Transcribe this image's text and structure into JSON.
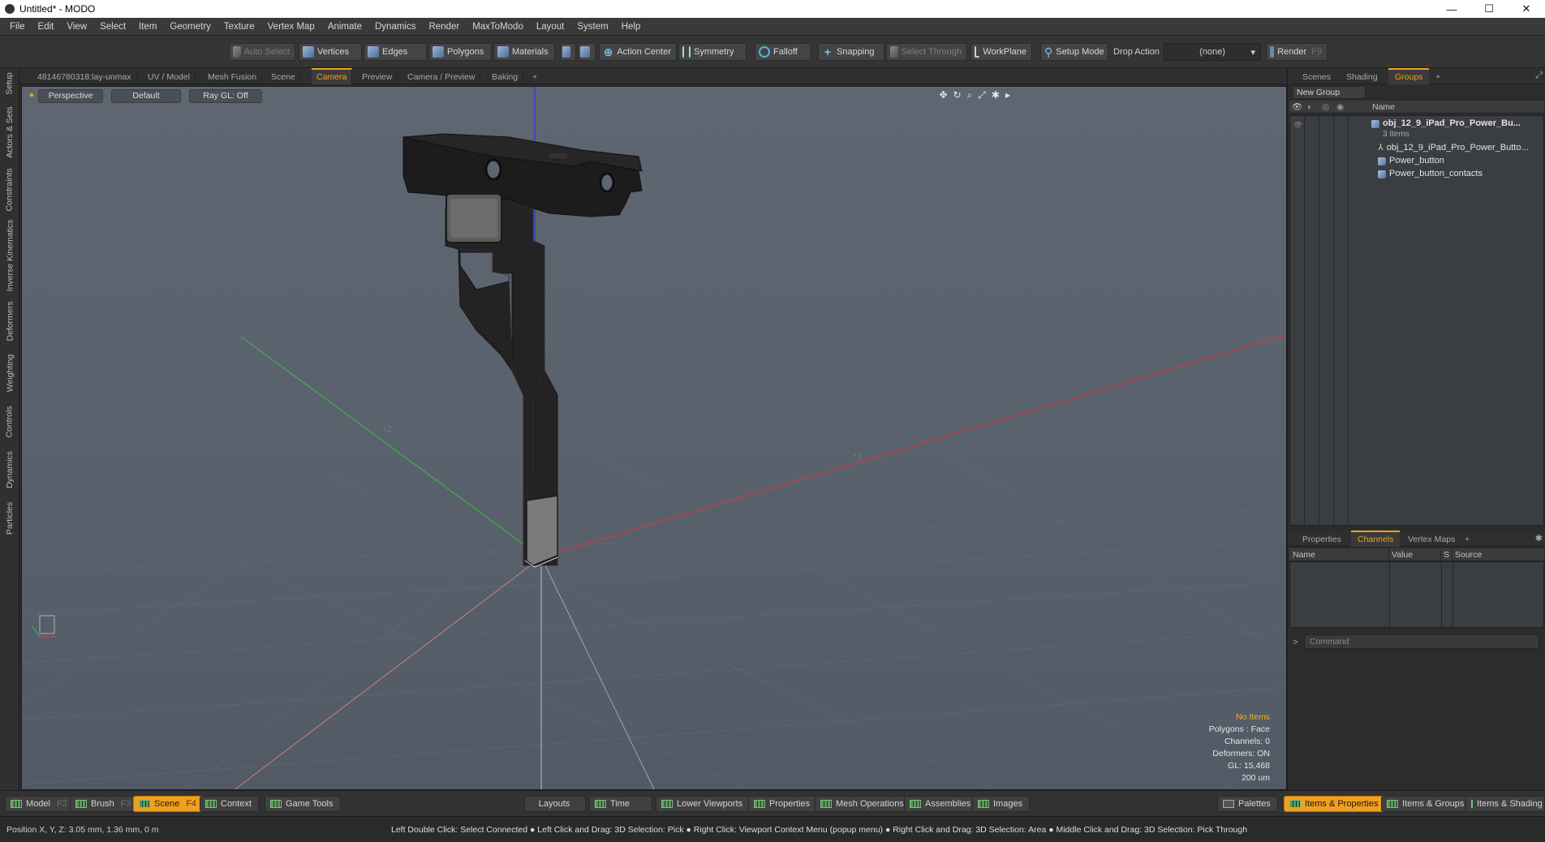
{
  "window": {
    "title": "Untitled* - MODO",
    "controls": [
      "—",
      "☐",
      "✕"
    ]
  },
  "menu": [
    "File",
    "Edit",
    "View",
    "Select",
    "Item",
    "Geometry",
    "Texture",
    "Vertex Map",
    "Animate",
    "Dynamics",
    "Render",
    "MaxToModo",
    "Layout",
    "System",
    "Help"
  ],
  "toolbar": {
    "auto_select": "Auto Select",
    "vertices": "Vertices",
    "edges": "Edges",
    "polygons": "Polygons",
    "materials": "Materials",
    "action_center": "Action Center",
    "symmetry": "Symmetry",
    "falloff": "Falloff",
    "snapping": "Snapping",
    "select_through": "Select Through",
    "workplane": "WorkPlane",
    "setup_mode": "Setup Mode",
    "drop_action_label": "Drop Action",
    "drop_action_value": "(none)",
    "render": "Render",
    "render_key": "F9"
  },
  "left_tabs": [
    "Setup",
    "Actors & Sets",
    "Constraints",
    "Inverse Kinematics",
    "Deformers",
    "Weighting",
    "Controls",
    "Dynamics",
    "Particles"
  ],
  "viewport_tabs": {
    "items": [
      "48146780318:lay-unmax",
      "UV / Model",
      "Mesh Fusion",
      "Scene",
      "Camera",
      "Preview",
      "Camera / Preview",
      "Baking",
      "+"
    ],
    "active": "Camera"
  },
  "viewport": {
    "view_mode": "Perspective",
    "shading": "Default",
    "raygl": "Ray GL: Off",
    "axis_labels": {
      "z": "+Z",
      "x": "+X"
    },
    "info": {
      "items": "No Items",
      "polygons": "Polygons : Face",
      "channels": "Channels: 0",
      "deformers": "Deformers: ON",
      "gl": "GL: 15,468",
      "scale": "200 um"
    }
  },
  "right_panel": {
    "tabs": [
      "Scenes",
      "Shading",
      "Groups",
      "+"
    ],
    "active_tab": "Groups",
    "new_group": "New Group",
    "name_header": "Name",
    "tree": {
      "root": "obj_12_9_iPad_Pro_Power_Bu...",
      "root_sub": "3 Items",
      "children": [
        "obj_12_9_iPad_Pro_Power_Butto...",
        "Power_button",
        "Power_button_contacts"
      ]
    },
    "bottom_tabs": [
      "Properties",
      "Channels",
      "Vertex Maps",
      "+"
    ],
    "bottom_active": "Channels",
    "channel_headers": {
      "name": "Name",
      "value": "Value",
      "s": "S",
      "source": "Source"
    },
    "command_placeholder": "Command"
  },
  "bottom_bar": {
    "model": "Model",
    "model_key": "F2",
    "brush": "Brush",
    "brush_key": "F3",
    "scene": "Scene",
    "scene_key": "F4",
    "context": "Context",
    "game_tools": "Game Tools",
    "layouts": "Layouts",
    "time": "Time",
    "lower_viewports": "Lower Viewports",
    "properties": "Properties",
    "mesh_operations": "Mesh Operations",
    "assemblies": "Assemblies",
    "images": "Images",
    "palettes": "Palettes",
    "items_properties": "Items & Properties",
    "items_groups": "Items & Groups",
    "items_shading": "Items & Shading"
  },
  "status": {
    "position": "Position X, Y, Z:   3.05 mm, 1.36 mm, 0 m",
    "hint": "Left Double Click: Select Connected ● Left Click and Drag: 3D Selection: Pick ● Right Click: Viewport Context Menu (popup menu) ● Right Click and Drag: 3D Selection: Area ● Middle Click and Drag: 3D Selection: Pick Through"
  }
}
